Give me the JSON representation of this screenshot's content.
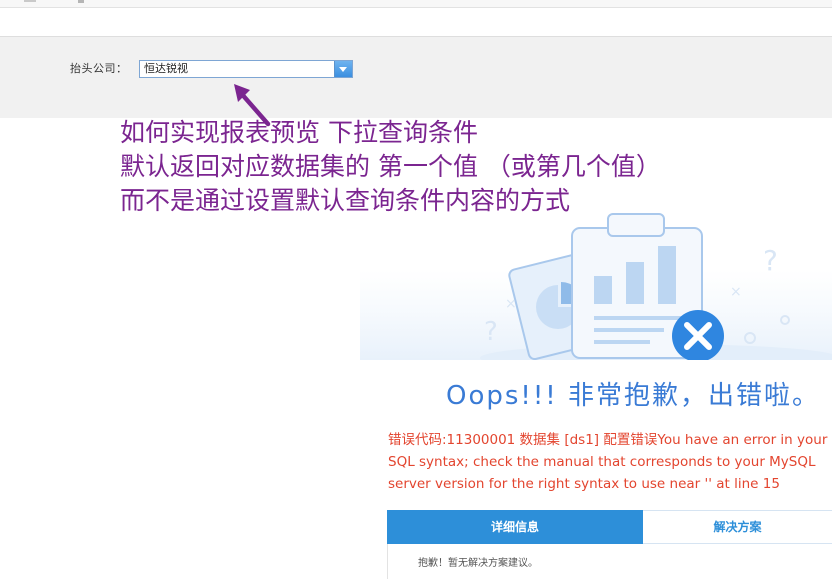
{
  "params": {
    "company_label": "抬头公司：",
    "company_value": "恒达锐视"
  },
  "annotation": {
    "lines": [
      "如何实现报表预览 下拉查询条件",
      "默认返回对应数据集的 第一个值 （或第几个值）",
      "而不是通过设置默认查询条件内容的方式"
    ],
    "color": "#7b2590"
  },
  "error": {
    "title": "Oops!!! 非常抱歉，出错啦。",
    "message_lines": [
      "错误代码:11300001 数据集 [ds1] 配置错误You have an error in your",
      "SQL syntax; check the manual that corresponds to your MySQL",
      "server version for the right syntax to use near '' at line 15"
    ],
    "tabs": {
      "detail": "详细信息",
      "solution": "解决方案"
    },
    "panel_text": "抱歉！暂无解决方案建议。"
  },
  "colors": {
    "accent": "#2d8fd9",
    "error": "#e3452f",
    "title": "#3a7bd5"
  }
}
